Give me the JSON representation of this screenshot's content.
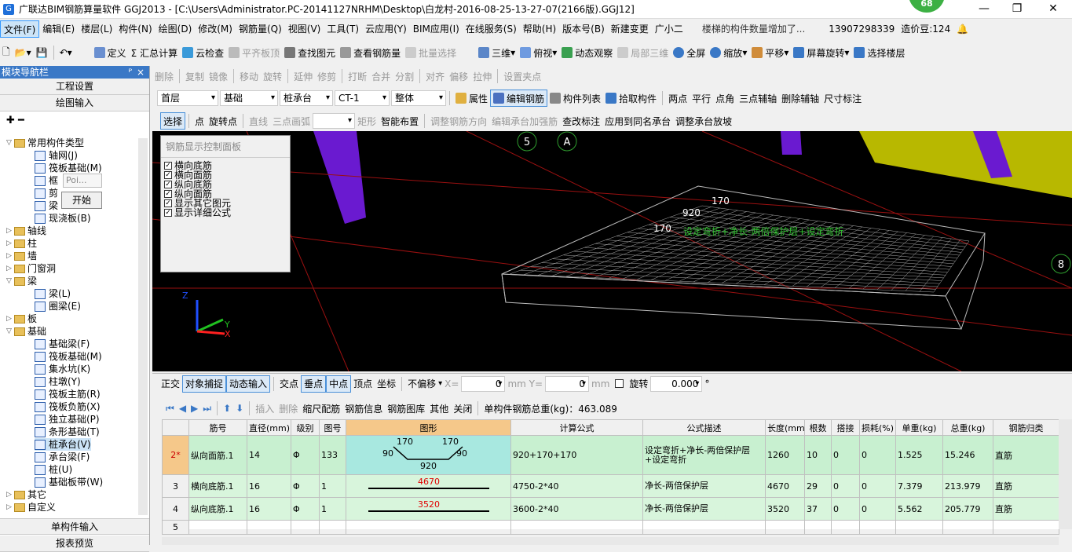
{
  "window": {
    "title": "广联达BIM钢筋算量软件 GGJ2013 - [C:\\Users\\Administrator.PC-20141127NRHM\\Desktop\\白龙村-2016-08-25-13-27-07(2166版).GGJ12]",
    "badge": "68",
    "min": "—",
    "max": "❐",
    "close": "✕"
  },
  "menu": {
    "items": [
      "文件(F)",
      "编辑(E)",
      "楼层(L)",
      "构件(N)",
      "绘图(D)",
      "修改(M)",
      "钢筋量(Q)",
      "视图(V)",
      "工具(T)",
      "云应用(Y)",
      "BIM应用(I)",
      "在线服务(S)",
      "帮助(H)",
      "版本号(B)",
      "新建变更",
      "广小二"
    ],
    "notice": "楼梯的构件数量增加了...",
    "phone": "13907298339",
    "cost": "造价豆:124"
  },
  "toolbar1": [
    "定义",
    "Σ 汇总计算",
    "云检查",
    "平齐板顶",
    "查找图元",
    "查看钢筋量",
    "批量选择",
    "三维",
    "俯视",
    "动态观察",
    "局部三维",
    "全屏",
    "缩放",
    "平移",
    "屏幕旋转",
    "选择楼层"
  ],
  "toolbar2": [
    "删除",
    "复制",
    "镜像",
    "移动",
    "旋转",
    "延伸",
    "修剪",
    "打断",
    "合并",
    "分割",
    "对齐",
    "偏移",
    "拉伸",
    "设置夹点"
  ],
  "toolbar3": {
    "floor": "首层",
    "category": "基础",
    "type": "桩承台",
    "name": "CT-1",
    "scope": "整体",
    "buttons": [
      "属性",
      "编辑钢筋",
      "构件列表",
      "拾取构件",
      "两点",
      "平行",
      "点角",
      "三点辅轴",
      "删除辅轴",
      "尺寸标注"
    ]
  },
  "toolbar4": [
    "选择",
    "点",
    "旋转点",
    "直线",
    "三点画弧",
    "矩形",
    "智能布置",
    "调整钢筋方向",
    "编辑承台加强筋",
    "查改标注",
    "应用到同名承台",
    "调整承台放坡"
  ],
  "nav": {
    "title": "模块导航栏",
    "pin": "ᴾ",
    "close": "×",
    "section_project": "工程设置",
    "section_draw": "绘图输入",
    "section_single": "单构件输入",
    "section_report": "报表预览",
    "tree": [
      {
        "l": 0,
        "t": "常用构件类型",
        "f": 1,
        "e": "▽"
      },
      {
        "l": 1,
        "t": "轴网(J)"
      },
      {
        "l": 1,
        "t": "筏板基础(M)"
      },
      {
        "l": 1,
        "t": "框"
      },
      {
        "l": 1,
        "t": "剪"
      },
      {
        "l": 1,
        "t": "梁"
      },
      {
        "l": 1,
        "t": "现浇板(B)"
      },
      {
        "l": 0,
        "t": "轴线",
        "f": 1,
        "e": "▷"
      },
      {
        "l": 0,
        "t": "柱",
        "f": 1,
        "e": "▷"
      },
      {
        "l": 0,
        "t": "墙",
        "f": 1,
        "e": "▷"
      },
      {
        "l": 0,
        "t": "门窗洞",
        "f": 1,
        "e": "▷"
      },
      {
        "l": 0,
        "t": "梁",
        "f": 1,
        "e": "▽"
      },
      {
        "l": 1,
        "t": "梁(L)"
      },
      {
        "l": 1,
        "t": "圈梁(E)"
      },
      {
        "l": 0,
        "t": "板",
        "f": 1,
        "e": "▷"
      },
      {
        "l": 0,
        "t": "基础",
        "f": 1,
        "e": "▽"
      },
      {
        "l": 1,
        "t": "基础梁(F)"
      },
      {
        "l": 1,
        "t": "筏板基础(M)"
      },
      {
        "l": 1,
        "t": "集水坑(K)"
      },
      {
        "l": 1,
        "t": "柱墩(Y)"
      },
      {
        "l": 1,
        "t": "筏板主筋(R)"
      },
      {
        "l": 1,
        "t": "筏板负筋(X)"
      },
      {
        "l": 1,
        "t": "独立基础(P)"
      },
      {
        "l": 1,
        "t": "条形基础(T)"
      },
      {
        "l": 1,
        "t": "桩承台(V)",
        "sel": 1
      },
      {
        "l": 1,
        "t": "承台梁(F)"
      },
      {
        "l": 1,
        "t": "桩(U)"
      },
      {
        "l": 1,
        "t": "基础板带(W)"
      },
      {
        "l": 0,
        "t": "其它",
        "f": 1,
        "e": "▷"
      },
      {
        "l": 0,
        "t": "自定义",
        "f": 1,
        "e": "▷"
      }
    ],
    "popup_text": "Poi...",
    "popup_btn": "开始"
  },
  "panel": {
    "title": "钢筋显示控制面板",
    "items": [
      "横向底筋",
      "横向面筋",
      "纵向底筋",
      "纵向面筋",
      "显示其它图元",
      "显示详细公式"
    ]
  },
  "view": {
    "axis_labels": [
      "5",
      "A",
      "8"
    ],
    "dims": [
      "170",
      "920",
      "170"
    ],
    "overlay": "设定弯折+净长-两倍保护层+设定弯折",
    "axis": [
      "Z",
      "Y",
      "X"
    ]
  },
  "snap": {
    "items": [
      "正交",
      "对象捕捉",
      "动态输入",
      "交点",
      "垂点",
      "中点",
      "顶点",
      "坐标",
      "不偏移",
      "X=",
      "mm Y=",
      "mm",
      "旋转"
    ],
    "x": "0",
    "y": "0",
    "rot": "0.000",
    "deg": "°"
  },
  "rebar_toolbar": {
    "items": [
      "插入",
      "删除",
      "缩尺配筋",
      "钢筋信息",
      "钢筋图库",
      "其他",
      "关闭"
    ],
    "total": "单构件钢筋总重(kg)：463.089"
  },
  "table": {
    "headers": [
      "筋号",
      "直径(mm)",
      "级别",
      "图号",
      "图形",
      "计算公式",
      "公式描述",
      "长度(mm)",
      "根数",
      "搭接",
      "损耗(%)",
      "单重(kg)",
      "总重(kg)",
      "钢筋归类"
    ],
    "rows": [
      {
        "no": "2*",
        "cells": [
          "纵向面筋.1",
          "14",
          "Φ",
          "133",
          "",
          "920+170+170",
          "设定弯折+净长-两倍保护层+设定弯折",
          "1260",
          "10",
          "0",
          "0",
          "1.525",
          "15.246",
          "直筋"
        ],
        "shape": [
          "170",
          "170",
          "90",
          "920",
          "90"
        ]
      },
      {
        "no": "3",
        "cells": [
          "横向底筋.1",
          "16",
          "Φ",
          "1",
          "4670",
          "4750-2*40",
          "净长-两倍保护层",
          "4670",
          "29",
          "0",
          "0",
          "7.379",
          "213.979",
          "直筋"
        ]
      },
      {
        "no": "4",
        "cells": [
          "纵向底筋.1",
          "16",
          "Φ",
          "1",
          "3520",
          "3600-2*40",
          "净长-两倍保护层",
          "3520",
          "37",
          "0",
          "0",
          "5.562",
          "205.779",
          "直筋"
        ]
      },
      {
        "no": "5",
        "cells": [
          "",
          "",
          "",
          "",
          "",
          "",
          "",
          "",
          "",
          "",
          "",
          "",
          "",
          ""
        ]
      }
    ]
  }
}
